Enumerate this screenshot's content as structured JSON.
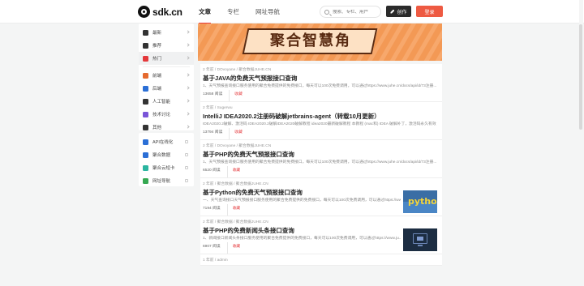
{
  "site": {
    "logo_text": "sdk.cn"
  },
  "nav": {
    "tabs": [
      "文章",
      "专栏",
      "网址导航"
    ],
    "active_index": 0
  },
  "search": {
    "placeholder": "搜索、专栏、用户"
  },
  "actions": {
    "create_label": "创作",
    "login_label": "登录"
  },
  "sidebar": {
    "categories": [
      {
        "label": "最新",
        "icon": "new-icon",
        "color": "#333333"
      },
      {
        "label": "推荐",
        "icon": "recommend-icon",
        "color": "#333333"
      },
      {
        "label": "热门",
        "icon": "hot-icon",
        "color": "#e4393c",
        "active": true
      },
      {
        "label": "前端",
        "icon": "html5-icon",
        "color": "#e56a2f"
      },
      {
        "label": "后端",
        "icon": "backend-icon",
        "color": "#2b6fd6"
      },
      {
        "label": "人工智能",
        "icon": "ai-icon",
        "color": "#333333"
      },
      {
        "label": "技术讨论",
        "icon": "discussion-icon",
        "color": "#7a55d8"
      },
      {
        "label": "其他",
        "icon": "other-icon",
        "color": "#333333"
      }
    ],
    "tools": [
      {
        "label": "API在线化",
        "icon": "api-icon",
        "color": "#2b6fd6"
      },
      {
        "label": "聚合数据",
        "icon": "juhe-data-icon",
        "color": "#2b6fd6"
      },
      {
        "label": "聚合云短卡",
        "icon": "cloud-card-icon",
        "color": "#2bb5a0"
      },
      {
        "label": "网址导航",
        "icon": "nav-icon",
        "color": "#36a852"
      }
    ]
  },
  "banner": {
    "title": "聚合智慧角"
  },
  "articles": [
    {
      "meta": "2 年前  /  DOvoyane  /  聚合数据JUHE.CN",
      "title": "基于JAVA的免费天气预报接口查询",
      "summary": "1、天气预报查询接口服务使用的聚合免费提供的免费接口，每天可以100次免费调用，可以通过https://www.juhe.cn/docs/api/id/73注册...",
      "views": "13658 阅读",
      "fav": "收藏"
    },
    {
      "meta": "2 年前  /  Sugerwu",
      "title": "IntelliJ IDEA2020.2注册码破解jetbrains-agent（转载10月更新）",
      "summary": "IDEA2020.2破解、激活码 IDEA2020.2破解IDEA2020破解教程 idea2020最新破解教程 本教程 (mac和) IDEA 破解补丁，激活码永久有效",
      "views": "13794 阅读",
      "fav": "收藏"
    },
    {
      "meta": "2 年前  /  DOvoyane  /  聚合数据JUHE.CN",
      "title": "基于PHP的免费天气预报接口查询",
      "summary": "1、天气预报查询接口服务使用的聚合免费提供的免费接口，每天可以100次免费调用，可以通过https://www.juhe.cn/docs/api/id/73注册...",
      "views": "6520 阅读",
      "fav": "收藏"
    },
    {
      "meta": "2 年前  /  聚合数据  /  聚合数据JUHE.CN",
      "title": "基于Python的免费天气预报接口查询",
      "summary": "一、天气查询接口天气预报接口服务使用的聚合免费提供的免费接口，每天可以100次免费调用，可以通过https://www.ju...",
      "views": "7194 阅读",
      "fav": "收藏",
      "thumb": "python"
    },
    {
      "meta": "2 年前  /  聚合数据  /  聚合数据JUHE.CN",
      "title": "基于PHP的免费新闻头条接口查询",
      "summary": "1、新闻接口新闻头条接口服务使用的聚合免费提供的免费接口，每天可以100次免费调用，可以通过https://www.ju...",
      "views": "6907 阅读",
      "fav": "收藏",
      "thumb": "php"
    },
    {
      "meta": "1 年前  /  admin"
    }
  ]
}
